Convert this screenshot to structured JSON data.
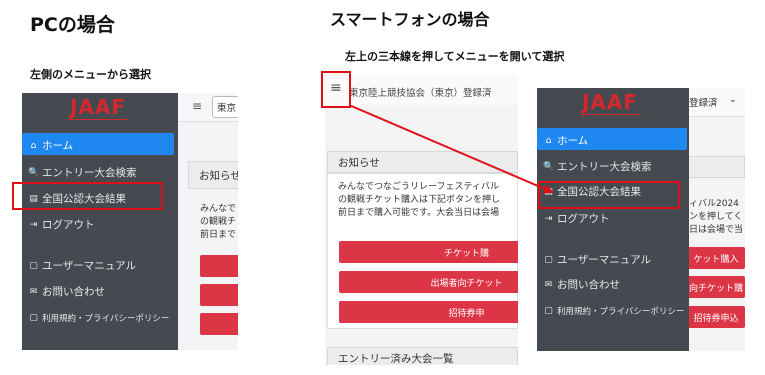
{
  "pc": {
    "title": "PCの場合",
    "subtitle": "左側のメニューから選択",
    "logo": "JAAF",
    "menu": [
      {
        "icon": "⌂",
        "label": "ホーム"
      },
      {
        "icon": "🔍",
        "label": "エントリー大会検索"
      },
      {
        "icon": "▤",
        "label": "全国公認大会結果"
      },
      {
        "icon": "⇥",
        "label": "ログアウト"
      },
      {
        "icon": "▢",
        "label": "ユーザーマニュアル"
      },
      {
        "icon": "✉",
        "label": "お問い合わせ"
      },
      {
        "icon": "▢",
        "label": "利用規約・プライバシーポリシー"
      }
    ],
    "select": "東京",
    "notice_header": "お知らせ",
    "notice_lines": [
      "みんなで",
      "の観戦チ",
      "前日まで"
    ]
  },
  "sp": {
    "title": "スマートフォンの場合",
    "subtitle": "左上の三本線を押してメニューを開いて選択",
    "hamburger": "≡",
    "select": "東京陸上競技協会（東京）登録済",
    "notice_header": "お知らせ",
    "notice_lines": [
      "みんなでつなごうリレーフェスティバル",
      "の観戦チケット購入は下記ボタンを押し",
      "前日まで購入可能です。大会当日は会場"
    ],
    "buttons": [
      "チケット購",
      "出場者向チケット",
      "招待券申"
    ],
    "entry_header": "エントリー済み大会一覧",
    "logo": "JAAF",
    "select_right": "登録済",
    "menu": [
      {
        "icon": "⌂",
        "label": "ホーム"
      },
      {
        "icon": "🔍",
        "label": "エントリー大会検索"
      },
      {
        "icon": "▤",
        "label": "全国公認大会結果"
      },
      {
        "icon": "⇥",
        "label": "ログアウト"
      },
      {
        "icon": "▢",
        "label": "ユーザーマニュアル"
      },
      {
        "icon": "✉",
        "label": "お問い合わせ"
      },
      {
        "icon": "▢",
        "label": "利用規約・プライバシーポリシー"
      }
    ],
    "right_lines": [
      "ィバル2024",
      "ンを押してく",
      "日は会場で当"
    ],
    "right_buttons": [
      "ケット購入",
      "向チケット購",
      "招待券申込"
    ]
  },
  "colors": {
    "sidebar": "#444a50",
    "active": "#1e88f0",
    "logo": "#d4282c",
    "button": "#dc3545",
    "highlight": "#e0101a"
  }
}
